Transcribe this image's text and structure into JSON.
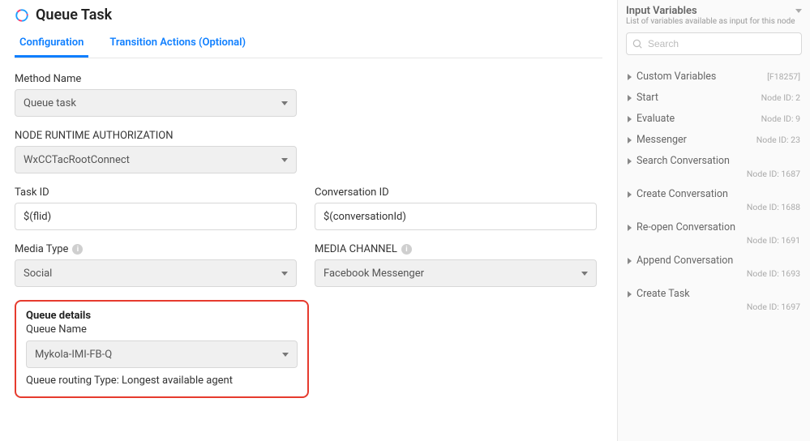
{
  "header": {
    "title": "Queue Task"
  },
  "tabs": {
    "config": "Configuration",
    "transition": "Transition Actions (Optional)"
  },
  "form": {
    "method_name_label": "Method Name",
    "method_name_value": "Queue task",
    "runtime_auth_label": "NODE RUNTIME AUTHORIZATION",
    "runtime_auth_value": "WxCCTacRootConnect",
    "task_id_label": "Task ID",
    "task_id_value": "$(flid)",
    "conv_id_label": "Conversation ID",
    "conv_id_value": "$(conversationId)",
    "media_type_label": "Media Type",
    "media_type_value": "Social",
    "media_channel_label": "MEDIA CHANNEL",
    "media_channel_value": "Facebook Messenger"
  },
  "queue": {
    "section_title": "Queue details",
    "name_label": "Queue Name",
    "name_value": "Mykola-IMI-FB-Q",
    "routing_label": "Queue routing Type:",
    "routing_value": "Longest available agent"
  },
  "sidebar": {
    "title": "Input Variables",
    "subtitle": "List of variables available as input for this node",
    "search_placeholder": "Search",
    "items": [
      {
        "name": "Custom Variables",
        "id": "[F18257]",
        "inline": true
      },
      {
        "name": "Start",
        "id": "Node ID: 2",
        "inline": true
      },
      {
        "name": "Evaluate",
        "id": "Node ID: 9",
        "inline": true
      },
      {
        "name": "Messenger",
        "id": "Node ID: 23",
        "inline": true
      },
      {
        "name": "Search Conversation",
        "id": "Node ID: 1687",
        "inline": false
      },
      {
        "name": "Create Conversation",
        "id": "Node ID: 1688",
        "inline": false
      },
      {
        "name": "Re-open Conversation",
        "id": "Node ID: 1691",
        "inline": false
      },
      {
        "name": "Append Conversation",
        "id": "Node ID: 1693",
        "inline": false
      },
      {
        "name": "Create Task",
        "id": "Node ID: 1697",
        "inline": false
      }
    ]
  }
}
